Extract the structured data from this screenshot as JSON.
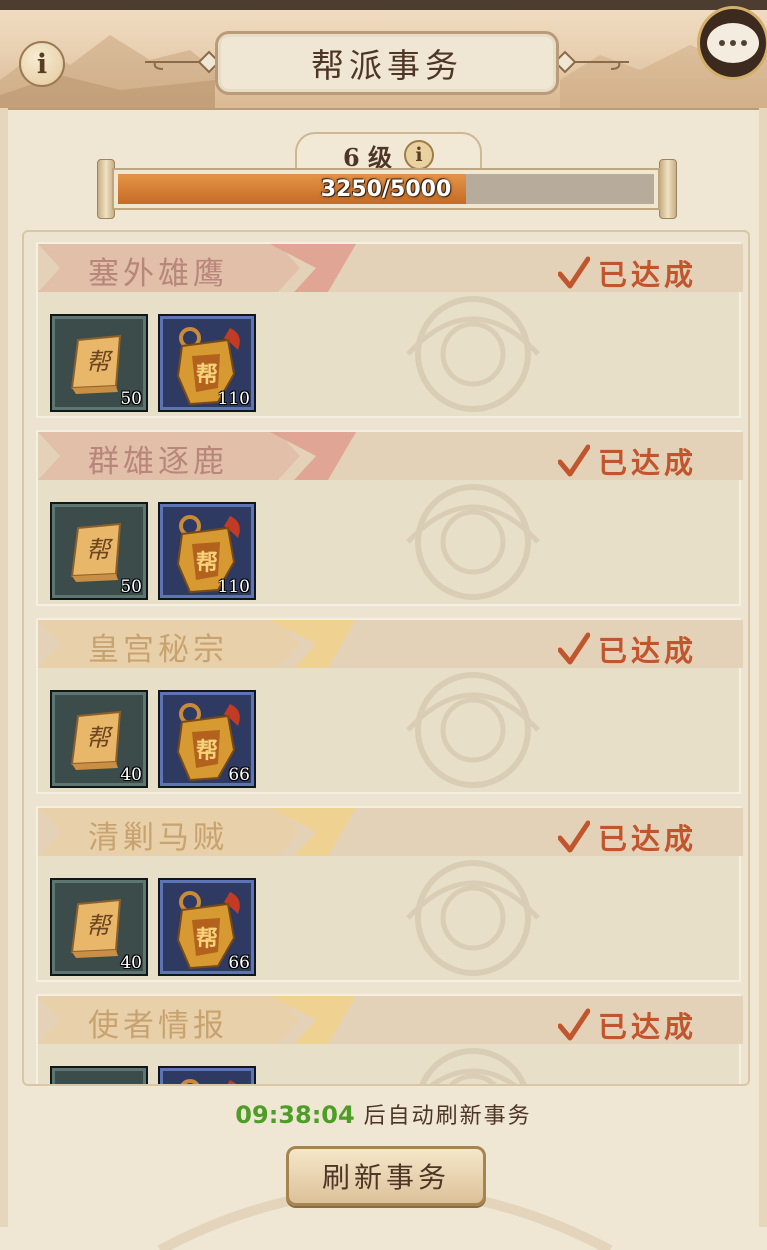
{
  "header": {
    "title": "帮派事务",
    "icons": [
      "info-icon",
      "chat-icon"
    ]
  },
  "level": {
    "label": "6 级",
    "progress_text": "3250/5000",
    "progress_current": 3250,
    "progress_max": 5000
  },
  "tasks": [
    {
      "name": "塞外雄鹰",
      "status": "已达成",
      "theme": "red",
      "rewards": [
        {
          "icon": "gang-token-icon",
          "qty": "50"
        },
        {
          "icon": "gang-badge-icon",
          "qty": "110"
        }
      ]
    },
    {
      "name": "群雄逐鹿",
      "status": "已达成",
      "theme": "red",
      "rewards": [
        {
          "icon": "gang-token-icon",
          "qty": "50"
        },
        {
          "icon": "gang-badge-icon",
          "qty": "110"
        }
      ]
    },
    {
      "name": "皇宫秘宗",
      "status": "已达成",
      "theme": "gold",
      "rewards": [
        {
          "icon": "gang-token-icon",
          "qty": "40"
        },
        {
          "icon": "gang-badge-icon",
          "qty": "66"
        }
      ]
    },
    {
      "name": "清剿马贼",
      "status": "已达成",
      "theme": "gold",
      "rewards": [
        {
          "icon": "gang-token-icon",
          "qty": "40"
        },
        {
          "icon": "gang-badge-icon",
          "qty": "66"
        }
      ]
    },
    {
      "name": "使者情报",
      "status": "已达成",
      "theme": "gold",
      "rewards": [
        {
          "icon": "gang-token-icon",
          "qty": ""
        },
        {
          "icon": "gang-badge-icon",
          "qty": ""
        }
      ]
    }
  ],
  "token_glyph": "帮",
  "footer": {
    "timer": "09:38:04",
    "timer_suffix": " 后自动刷新事务",
    "refresh_label": "刷新事务"
  },
  "colors": {
    "done_red": "#c0552e",
    "timer_green": "#4d9e27",
    "red_tag": "#df9d8d",
    "gold_tag": "#f0d18e"
  }
}
